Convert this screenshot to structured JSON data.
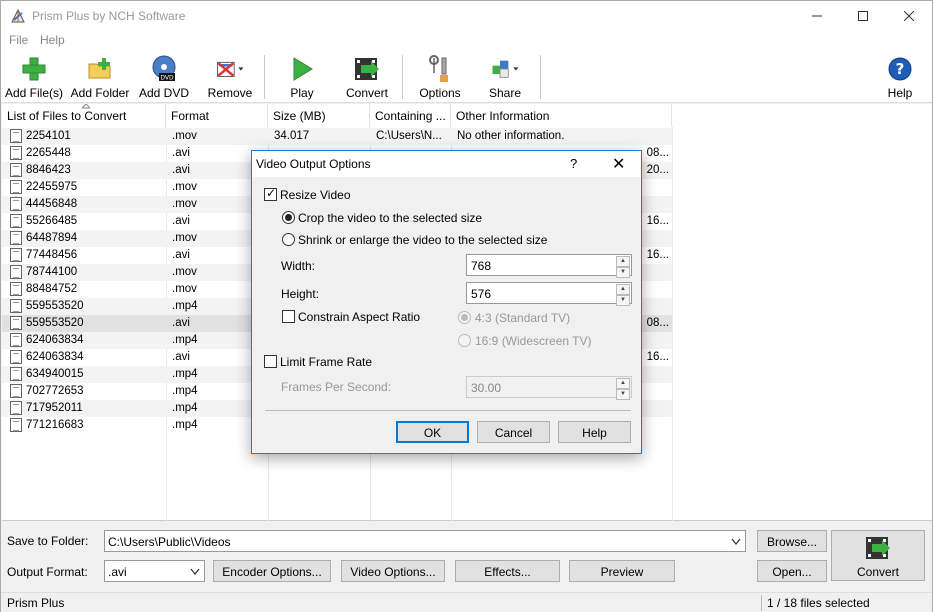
{
  "window": {
    "title": "Prism Plus by NCH Software"
  },
  "menu": [
    "File",
    "Help"
  ],
  "toolbar": {
    "add_files": "Add File(s)",
    "add_folder": "Add Folder",
    "add_dvd": "Add DVD",
    "remove": "Remove",
    "play": "Play",
    "convert": "Convert",
    "options": "Options",
    "share": "Share",
    "help": "Help",
    "dvd_badge": "DVD"
  },
  "list": {
    "headers": [
      "List of Files to Convert",
      "Format",
      "Size (MB)",
      "Containing ...",
      "Other Information"
    ],
    "rows": [
      {
        "name": "2254101",
        "format": ".mov",
        "size": "34.017",
        "folder": "C:\\Users\\N...",
        "info": "No other information."
      },
      {
        "name": "2265448",
        "format": ".avi",
        "size": "",
        "folder": "",
        "info": "08..."
      },
      {
        "name": "8846423",
        "format": ".avi",
        "size": "",
        "folder": "",
        "info": "20..."
      },
      {
        "name": "22455975",
        "format": ".mov",
        "size": "",
        "folder": "",
        "info": ""
      },
      {
        "name": "44456848",
        "format": ".mov",
        "size": "",
        "folder": "",
        "info": ""
      },
      {
        "name": "55266485",
        "format": ".avi",
        "size": "",
        "folder": "",
        "info": "16..."
      },
      {
        "name": "64487894",
        "format": ".mov",
        "size": "",
        "folder": "",
        "info": ""
      },
      {
        "name": "77448456",
        "format": ".avi",
        "size": "",
        "folder": "",
        "info": "16..."
      },
      {
        "name": "78744100",
        "format": ".mov",
        "size": "",
        "folder": "",
        "info": ""
      },
      {
        "name": "88484752",
        "format": ".mov",
        "size": "",
        "folder": "",
        "info": ""
      },
      {
        "name": "559553520",
        "format": ".mp4",
        "size": "",
        "folder": "",
        "info": ""
      },
      {
        "name": "559553520",
        "format": ".avi",
        "size": "",
        "folder": "",
        "info": "08..."
      },
      {
        "name": "624063834",
        "format": ".mp4",
        "size": "",
        "folder": "",
        "info": ""
      },
      {
        "name": "624063834",
        "format": ".avi",
        "size": "",
        "folder": "",
        "info": "16..."
      },
      {
        "name": "634940015",
        "format": ".mp4",
        "size": "",
        "folder": "",
        "info": ""
      },
      {
        "name": "702772653",
        "format": ".mp4",
        "size": "",
        "folder": "",
        "info": ""
      },
      {
        "name": "717952011",
        "format": ".mp4",
        "size": "",
        "folder": "",
        "info": ""
      },
      {
        "name": "771216683",
        "format": ".mp4",
        "size": "",
        "folder": "",
        "info": ""
      }
    ],
    "selected_row": 11
  },
  "bottom": {
    "save_label": "Save to Folder:",
    "save_value": "C:\\Users\\Public\\Videos",
    "browse": "Browse...",
    "format_label": "Output Format:",
    "format_value": ".avi",
    "encoder_options": "Encoder Options...",
    "video_options": "Video Options...",
    "effects": "Effects...",
    "preview": "Preview",
    "open": "Open...",
    "convert": "Convert"
  },
  "status": {
    "app": "Prism Plus",
    "selection": "1 / 18 files selected"
  },
  "dialog": {
    "title": "Video Output Options",
    "help_glyph": "?",
    "close_glyph": "✕",
    "resize_video": "Resize Video",
    "crop": "Crop the video to the selected size",
    "shrink": "Shrink or enlarge the video to the selected size",
    "width_label": "Width:",
    "width_value": "768",
    "height_label": "Height:",
    "height_value": "576",
    "constrain": "Constrain Aspect Ratio",
    "ratio_43": "4:3 (Standard TV)",
    "ratio_169": "16:9 (Widescreen TV)",
    "limit_frame_rate": "Limit Frame Rate",
    "fps_label": "Frames Per Second:",
    "fps_value": "30.00",
    "ok": "OK",
    "cancel": "Cancel",
    "help": "Help"
  },
  "colors": {
    "accent": "#0078d7",
    "green": "#3cb043",
    "selected_row": "#e1e1e1"
  }
}
